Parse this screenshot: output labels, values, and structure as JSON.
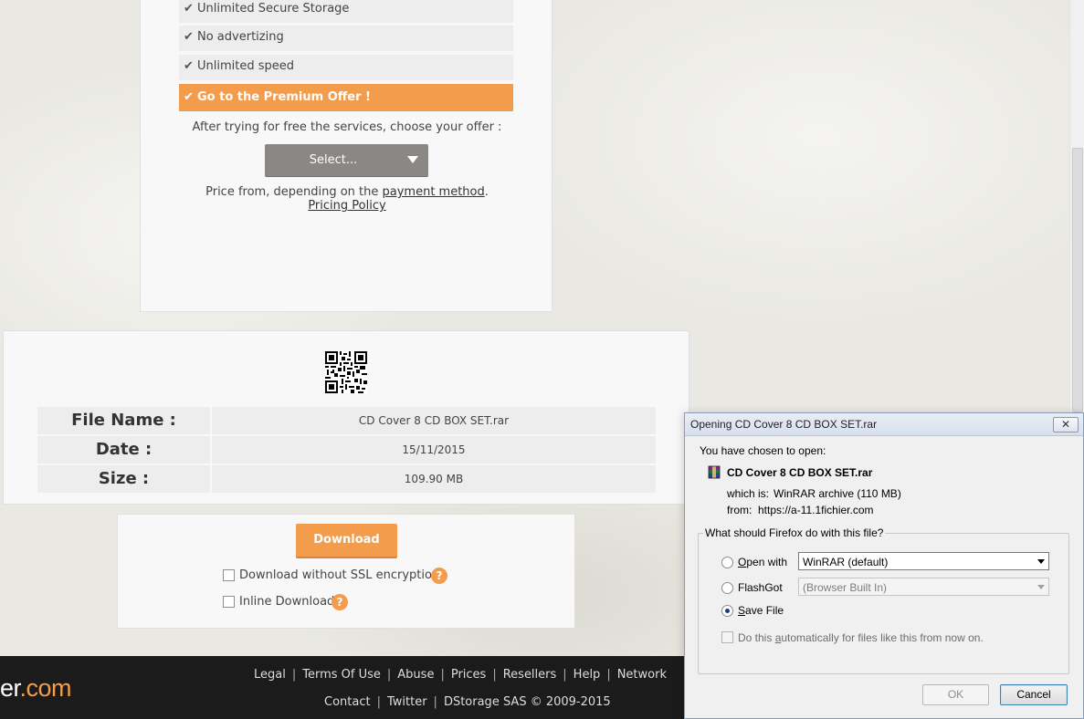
{
  "premium": {
    "features": [
      "Unlimited Secure Storage",
      "No advertizing",
      "Unlimited speed"
    ],
    "offer_label": "Go to the Premium Offer !",
    "choose_text": "After trying for free the services, choose your offer :",
    "select_label": "Select...",
    "price_prefix": "Price from, depending on the",
    "payment_method_link": "payment method",
    "price_suffix": ".",
    "pricing_policy_link": "Pricing Policy"
  },
  "file_info": {
    "rows": [
      {
        "label": "File Name :",
        "value": "CD Cover 8 CD BOX SET.rar"
      },
      {
        "label": "Date :",
        "value": "15/11/2015"
      },
      {
        "label": "Size :",
        "value": "109.90 MB"
      }
    ]
  },
  "download": {
    "button_label": "Download",
    "option_ssl": "Download without SSL encryption",
    "option_inline": "Inline Download",
    "help_glyph": "?"
  },
  "footer": {
    "logo_partial": "er",
    "logo_domain": ".com",
    "links_row1": [
      "Legal",
      "Terms Of Use",
      "Abuse",
      "Prices",
      "Resellers",
      "Help",
      "Network"
    ],
    "links_row2": [
      "Contact",
      "Twitter",
      "DStorage SAS © 2009-2015"
    ]
  },
  "dialog": {
    "title": "Opening CD Cover 8 CD BOX SET.rar",
    "close_glyph": "✕",
    "chosen_text": "You have chosen to open:",
    "file_name": "CD Cover 8 CD BOX SET.rar",
    "which_is_label": "which is:",
    "which_is_value": "WinRAR archive (110 MB)",
    "from_label": "from:",
    "from_value": "https://a-11.1fichier.com",
    "question": "What should Firefox do with this file?",
    "open_with_label_u": "O",
    "open_with_label_rest": "pen with",
    "open_with_value": "WinRAR (default)",
    "flashgot_label": "FlashGot",
    "flashgot_value": "(Browser Built In)",
    "save_file_label_u": "S",
    "save_file_label_rest": "ave File",
    "selected_option": "Save File",
    "auto_label_pre": "Do this ",
    "auto_label_u": "a",
    "auto_label_post": "utomatically for files like this from now on.",
    "ok_label": "OK",
    "cancel_label": "Cancel"
  },
  "colors": {
    "accent_orange": "#f39c4b",
    "select_grey": "#8a8885",
    "footer_bg": "#1b1b1b"
  }
}
